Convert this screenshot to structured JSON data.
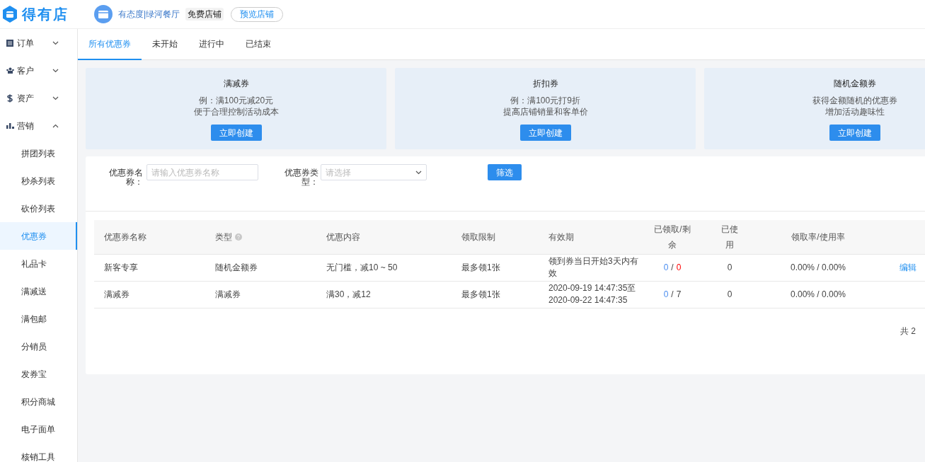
{
  "header": {
    "brand": "得有店",
    "store_name": "有态度|绿河餐厅",
    "store_badge": "免费店铺",
    "preview_button": "预览店铺"
  },
  "sidebar": {
    "items": [
      {
        "label": "订单",
        "expanded": false
      },
      {
        "label": "客户",
        "expanded": false
      },
      {
        "label": "资产",
        "expanded": false
      },
      {
        "label": "营销",
        "expanded": true,
        "children": [
          {
            "label": "拼团列表",
            "selected": false
          },
          {
            "label": "秒杀列表",
            "selected": false
          },
          {
            "label": "砍价列表",
            "selected": false
          },
          {
            "label": "优惠券",
            "selected": true
          },
          {
            "label": "礼品卡",
            "selected": false
          },
          {
            "label": "满减送",
            "selected": false
          },
          {
            "label": "满包邮",
            "selected": false
          },
          {
            "label": "分销员",
            "selected": false
          },
          {
            "label": "发券宝",
            "selected": false
          },
          {
            "label": "积分商城",
            "selected": false
          },
          {
            "label": "电子面单",
            "selected": false
          },
          {
            "label": "核销工具",
            "selected": false
          }
        ]
      }
    ]
  },
  "tabs": [
    {
      "label": "所有优惠券",
      "selected": true
    },
    {
      "label": "未开始",
      "selected": false
    },
    {
      "label": "进行中",
      "selected": false
    },
    {
      "label": "已结束",
      "selected": false
    }
  ],
  "coupon_cards": [
    {
      "title": "满减券",
      "lines": [
        "例：满100元减20元",
        "便于合理控制活动成本"
      ],
      "button": "立即创建"
    },
    {
      "title": "折扣券",
      "lines": [
        "例：满100元打9折",
        "提高店铺销量和客单价"
      ],
      "button": "立即创建"
    },
    {
      "title": "随机金额券",
      "lines": [
        "获得金额随机的优惠券",
        "增加活动趣味性"
      ],
      "button": "立即创建"
    }
  ],
  "filter": {
    "name_label": "优惠券名称：",
    "name_placeholder": "请输入优惠券名称",
    "type_label": "优惠券类型：",
    "type_placeholder": "请选择",
    "button": "筛选"
  },
  "table": {
    "columns": [
      "优惠券名称",
      "类型",
      "优惠内容",
      "领取限制",
      "有效期",
      "已领取/剩余",
      "已使用",
      "领取率/使用率"
    ],
    "count_separator": "/",
    "rows": [
      {
        "name": "新客专享",
        "type": "随机金额券",
        "content": "无门槛，减10 ~ 50",
        "limit": "最多领1张",
        "validity": "领到券当日开始3天内有效",
        "received": "0",
        "remaining": "0",
        "sold_out": true,
        "used": "0",
        "rates": "0.00% / 0.00%",
        "action": "编辑"
      },
      {
        "name": "满减券",
        "type": "满减券",
        "content": "满30，减12",
        "limit": "最多领1张",
        "validity": "2020-09-19 14:47:35至2020-09-22 14:47:35",
        "received": "0",
        "remaining": "7",
        "sold_out": false,
        "used": "0",
        "rates": "0.00% / 0.00%"
      }
    ]
  },
  "pagination": {
    "total": "共 2"
  }
}
